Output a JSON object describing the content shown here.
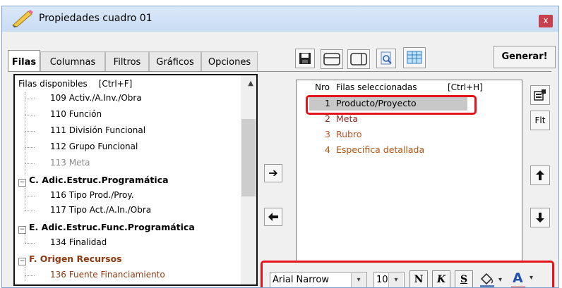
{
  "window": {
    "title": "Propiedades cuadro 01",
    "close_label": "x"
  },
  "tabs": [
    {
      "label": "Filas",
      "active": true
    },
    {
      "label": "Columnas",
      "active": false
    },
    {
      "label": "Filtros",
      "active": false
    },
    {
      "label": "Gráficos",
      "active": false
    },
    {
      "label": "Opciones",
      "active": false
    }
  ],
  "toolbar": {
    "icons": [
      "save-icon",
      "layout-rows-icon",
      "layout-columns-icon",
      "preview-icon",
      "grid-icon"
    ],
    "generate_label": "Generar!"
  },
  "available": {
    "header": "Filas disponibles",
    "shortcut": "[Ctrl+F]",
    "items": [
      {
        "label": "109 Activ./A.Inv./Obra",
        "kind": "leaf"
      },
      {
        "label": "110 Función",
        "kind": "leaf"
      },
      {
        "label": "111 División Funcional",
        "kind": "leaf"
      },
      {
        "label": "112 Grupo Funcional",
        "kind": "leaf"
      },
      {
        "label": "113 Meta",
        "kind": "leaf-disabled"
      },
      {
        "label": "C. Adic.Estruc.Programática",
        "kind": "group"
      },
      {
        "label": "116 Tipo Prod./Proy.",
        "kind": "leaf"
      },
      {
        "label": "117 Tipo Act./A.In./Obra",
        "kind": "leaf"
      },
      {
        "label": "E. Adic.Estruc.Func.Programática",
        "kind": "group"
      },
      {
        "label": "134 Finalidad",
        "kind": "leaf"
      },
      {
        "label": "F. Origen Recursos",
        "kind": "group-brown"
      },
      {
        "label": "136 Fuente Financiamiento",
        "kind": "leaf-brown"
      }
    ]
  },
  "move_buttons": {
    "add": "➔",
    "remove": "🡐"
  },
  "selected": {
    "col_nro": "Nro",
    "header": "Filas seleccionadas",
    "shortcut": "[Ctrl+H]",
    "rows": [
      {
        "num": "1",
        "label": "Producto/Proyecto",
        "color": "#000000"
      },
      {
        "num": "2",
        "label": "Meta",
        "color": "#8b2a1f"
      },
      {
        "num": "3",
        "label": "Rubro",
        "color": "#c8501e"
      },
      {
        "num": "4",
        "label": "Especifica detallada",
        "color": "#b0520f"
      }
    ]
  },
  "side_buttons": {
    "properties_icon": "properties-icon",
    "filter_label": "Flt",
    "up": "🡑",
    "down": "🡓"
  },
  "font_bar": {
    "font_name": "Arial Narrow",
    "font_size": "10",
    "bold_label": "N",
    "italic_label": "K",
    "strike_label": "S",
    "fill_icon": "fill-color-icon",
    "font_color_icon": "font-color-icon",
    "font_color_label": "A"
  },
  "colors": {
    "highlight": "#e3141b",
    "selected_row_bg": "#c8c8c8",
    "close_bg": "#c7404c"
  }
}
